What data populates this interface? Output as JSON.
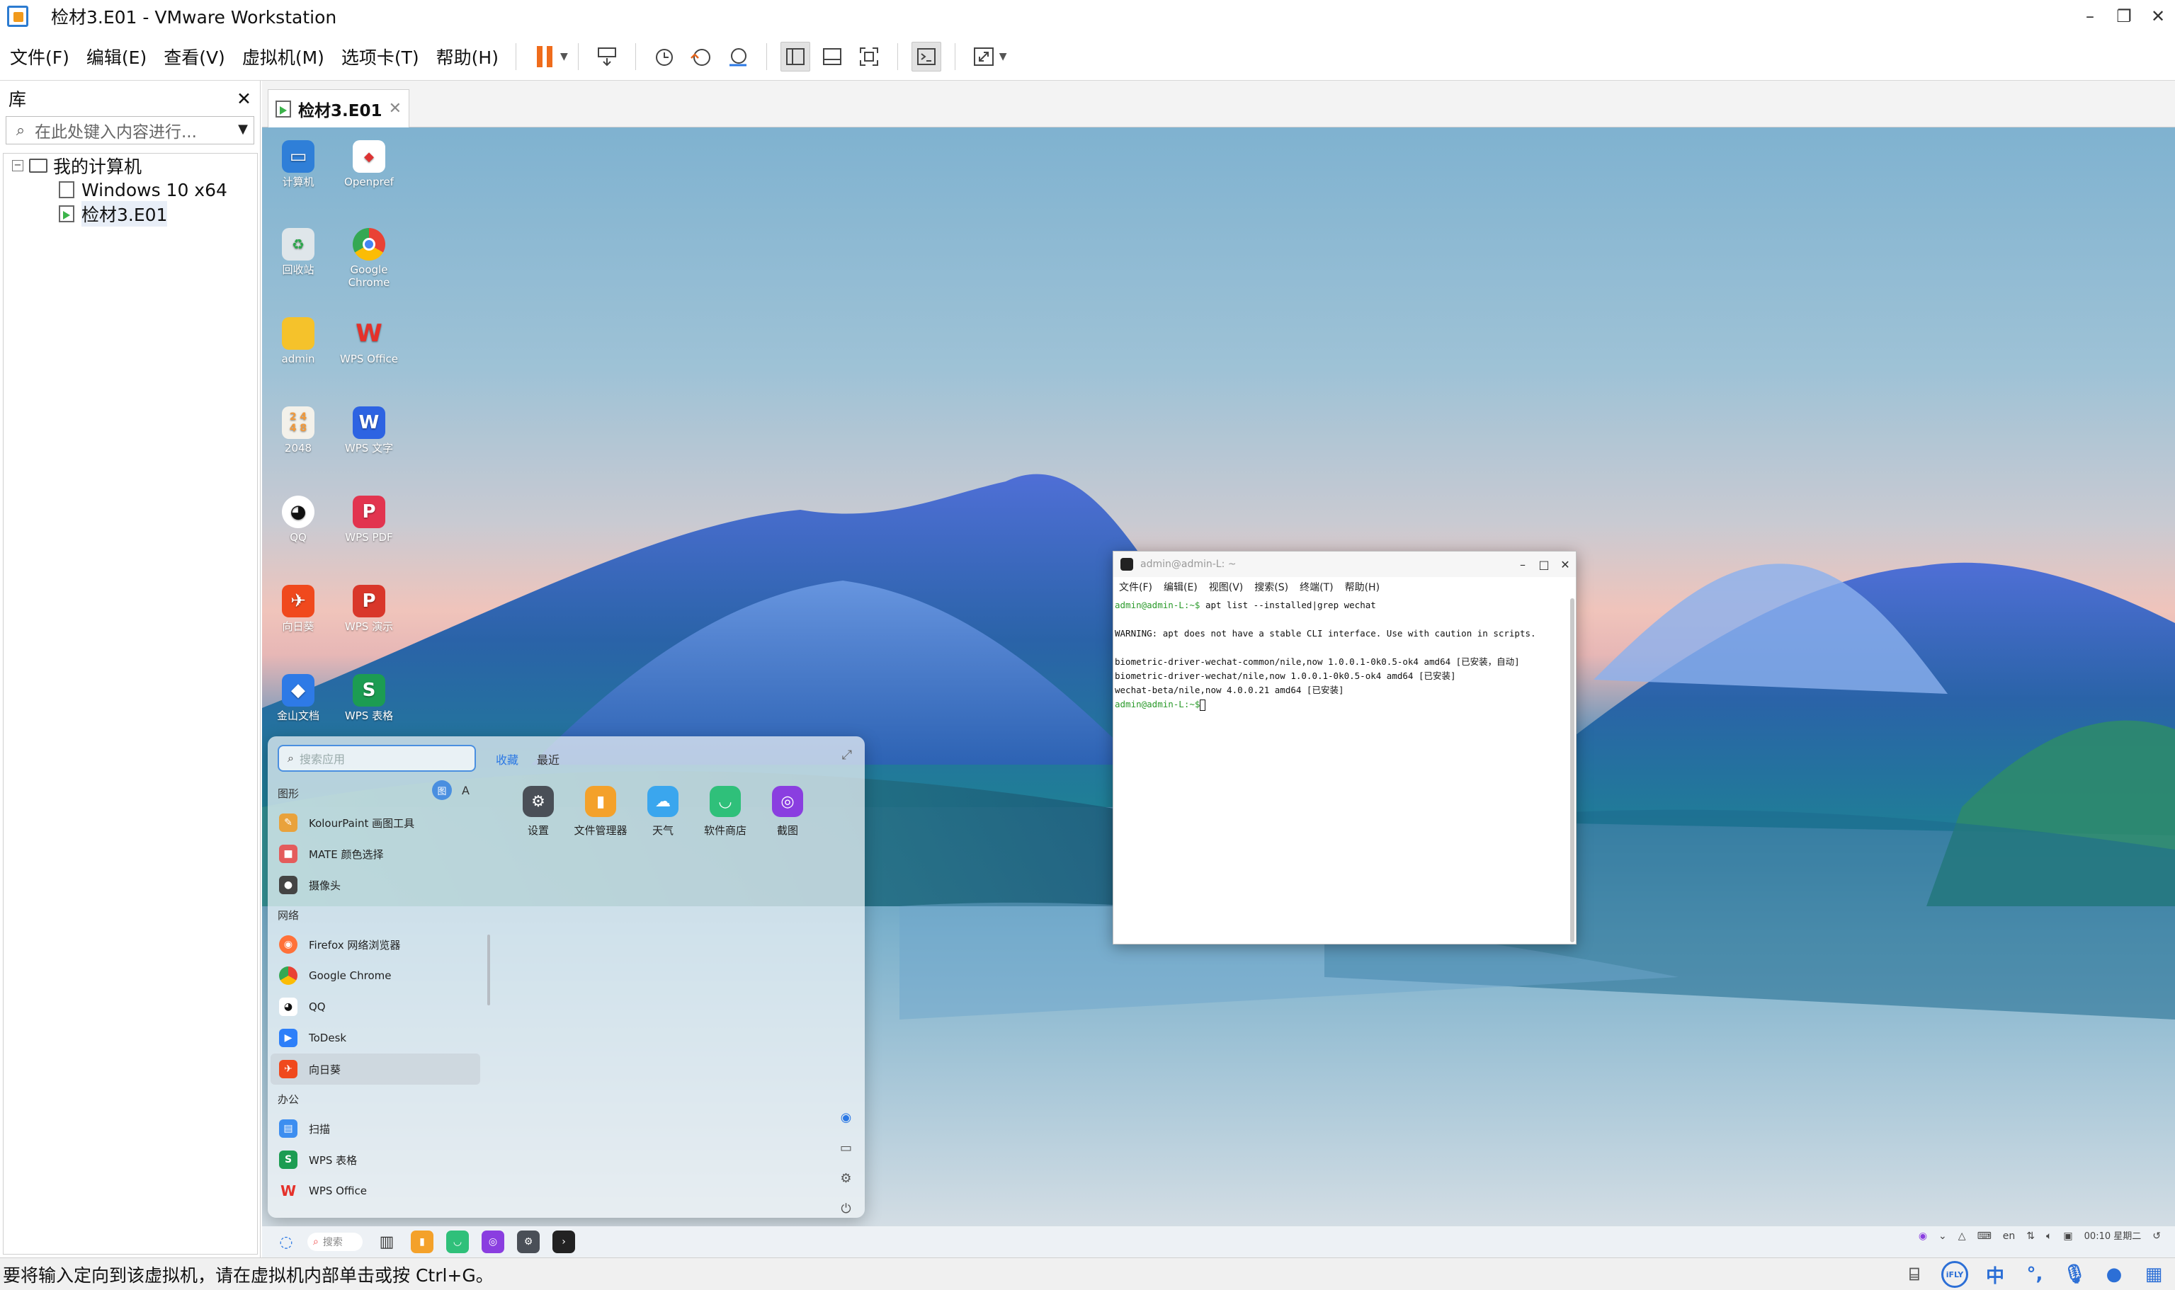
{
  "window": {
    "title": "检材3.E01 - VMware Workstation"
  },
  "menu": [
    "文件(F)",
    "编辑(E)",
    "查看(V)",
    "虚拟机(M)",
    "选项卡(T)",
    "帮助(H)"
  ],
  "library": {
    "title": "库",
    "search_placeholder": "在此处键入内容进行...",
    "root": "我的计算机",
    "vms": [
      "Windows 10 x64",
      "检材3.E01"
    ]
  },
  "tab": {
    "label": "检材3.E01"
  },
  "desktop_icons": [
    {
      "label": "计算机",
      "icon": "computer-icon",
      "color": "#2f7fd8"
    },
    {
      "label": "Openpref",
      "icon": "openpref-icon",
      "color": "#ffffff"
    },
    {
      "label": "回收站",
      "icon": "trash-icon",
      "color": "#dfe6ea"
    },
    {
      "label": "Google Chrome",
      "icon": "chrome-icon",
      "color": "#e94235"
    },
    {
      "label": "admin",
      "icon": "folder-icon",
      "color": "#f5c22b"
    },
    {
      "label": "WPS Office",
      "icon": "wps-office-icon",
      "color": "#e5312a"
    },
    {
      "label": "2048",
      "icon": "game-2048-icon",
      "color": "#f29a3b"
    },
    {
      "label": "WPS 文字",
      "icon": "wps-writer-icon",
      "color": "#2d63e2"
    },
    {
      "label": "QQ",
      "icon": "qq-icon",
      "color": "#111111"
    },
    {
      "label": "WPS PDF",
      "icon": "wps-pdf-icon",
      "color": "#e2344f"
    },
    {
      "label": "向日葵",
      "icon": "sunlogin-icon",
      "color": "#f0491d"
    },
    {
      "label": "WPS 演示",
      "icon": "wps-presentation-icon",
      "color": "#d9372a"
    },
    {
      "label": "金山文档",
      "icon": "kdocs-icon",
      "color": "#2e7ae6"
    },
    {
      "label": "WPS 表格",
      "icon": "wps-spreadsheet-icon",
      "color": "#1c9c52"
    }
  ],
  "terminal": {
    "title": "admin@admin-L: ~",
    "menu": [
      "文件(F)",
      "编辑(E)",
      "视图(V)",
      "搜索(S)",
      "终端(T)",
      "帮助(H)"
    ],
    "prompt": "admin@admin-L:~$",
    "command": " apt list --installed|grep wechat",
    "lines": [
      "",
      "WARNING: apt does not have a stable CLI interface. Use with caution in scripts.",
      "",
      "biometric-driver-wechat-common/nile,now 1.0.0.1-0k0.5-ok4 amd64 [已安装，自动]",
      "biometric-driver-wechat/nile,now 1.0.0.1-0k0.5-ok4 amd64 [已安装]",
      "wechat-beta/nile,now 4.0.0.21 amd64 [已安装]"
    ]
  },
  "startmenu": {
    "search_placeholder": "搜索应用",
    "tabs": [
      "收藏",
      "最近"
    ],
    "letters": [
      "图",
      "A"
    ],
    "categories": [
      {
        "name": "图形",
        "items": [
          {
            "label": "KolourPaint 画图工具",
            "color": "#e9a23b",
            "icon": "kolourpaint-icon"
          },
          {
            "label": "MATE 颜色选择",
            "color": "#e45c5c",
            "icon": "color-picker-icon"
          },
          {
            "label": "摄像头",
            "color": "#444444",
            "icon": "camera-icon"
          }
        ]
      },
      {
        "name": "网络",
        "items": [
          {
            "label": "Firefox 网络浏览器",
            "color": "#ff7139",
            "icon": "firefox-icon"
          },
          {
            "label": "Google Chrome",
            "color": "#34a853",
            "icon": "chrome-icon"
          },
          {
            "label": "QQ",
            "color": "#111111",
            "icon": "qq-icon"
          },
          {
            "label": "ToDesk",
            "color": "#2d7ff9",
            "icon": "todesk-icon"
          },
          {
            "label": "向日葵",
            "color": "#f0491d",
            "icon": "sunlogin-icon"
          }
        ]
      },
      {
        "name": "办公",
        "items": [
          {
            "label": "扫描",
            "color": "#3d8ef0",
            "icon": "scanner-icon"
          },
          {
            "label": "WPS 表格",
            "color": "#1c9c52",
            "icon": "wps-spreadsheet-icon"
          },
          {
            "label": "WPS Office",
            "color": "#e5312a",
            "icon": "wps-office-icon"
          }
        ]
      }
    ],
    "favorites": [
      {
        "label": "设置",
        "color": "#4a4f57",
        "icon": "settings-icon"
      },
      {
        "label": "文件管理器",
        "color": "#f4a12a",
        "icon": "file-manager-icon"
      },
      {
        "label": "天气",
        "color": "#3aa6ee",
        "icon": "weather-icon"
      },
      {
        "label": "软件商店",
        "color": "#2fc07a",
        "icon": "software-store-icon"
      },
      {
        "label": "截图",
        "color": "#8a3ee0",
        "icon": "screenshot-icon"
      }
    ]
  },
  "guest_taskbar": {
    "search_label": "搜索",
    "clock": "00:10 星期二"
  },
  "statusbar": {
    "text": "要将输入定向到该虚拟机，请在虚拟机内部单击或按 Ctrl+G。",
    "ime_label": "中"
  }
}
